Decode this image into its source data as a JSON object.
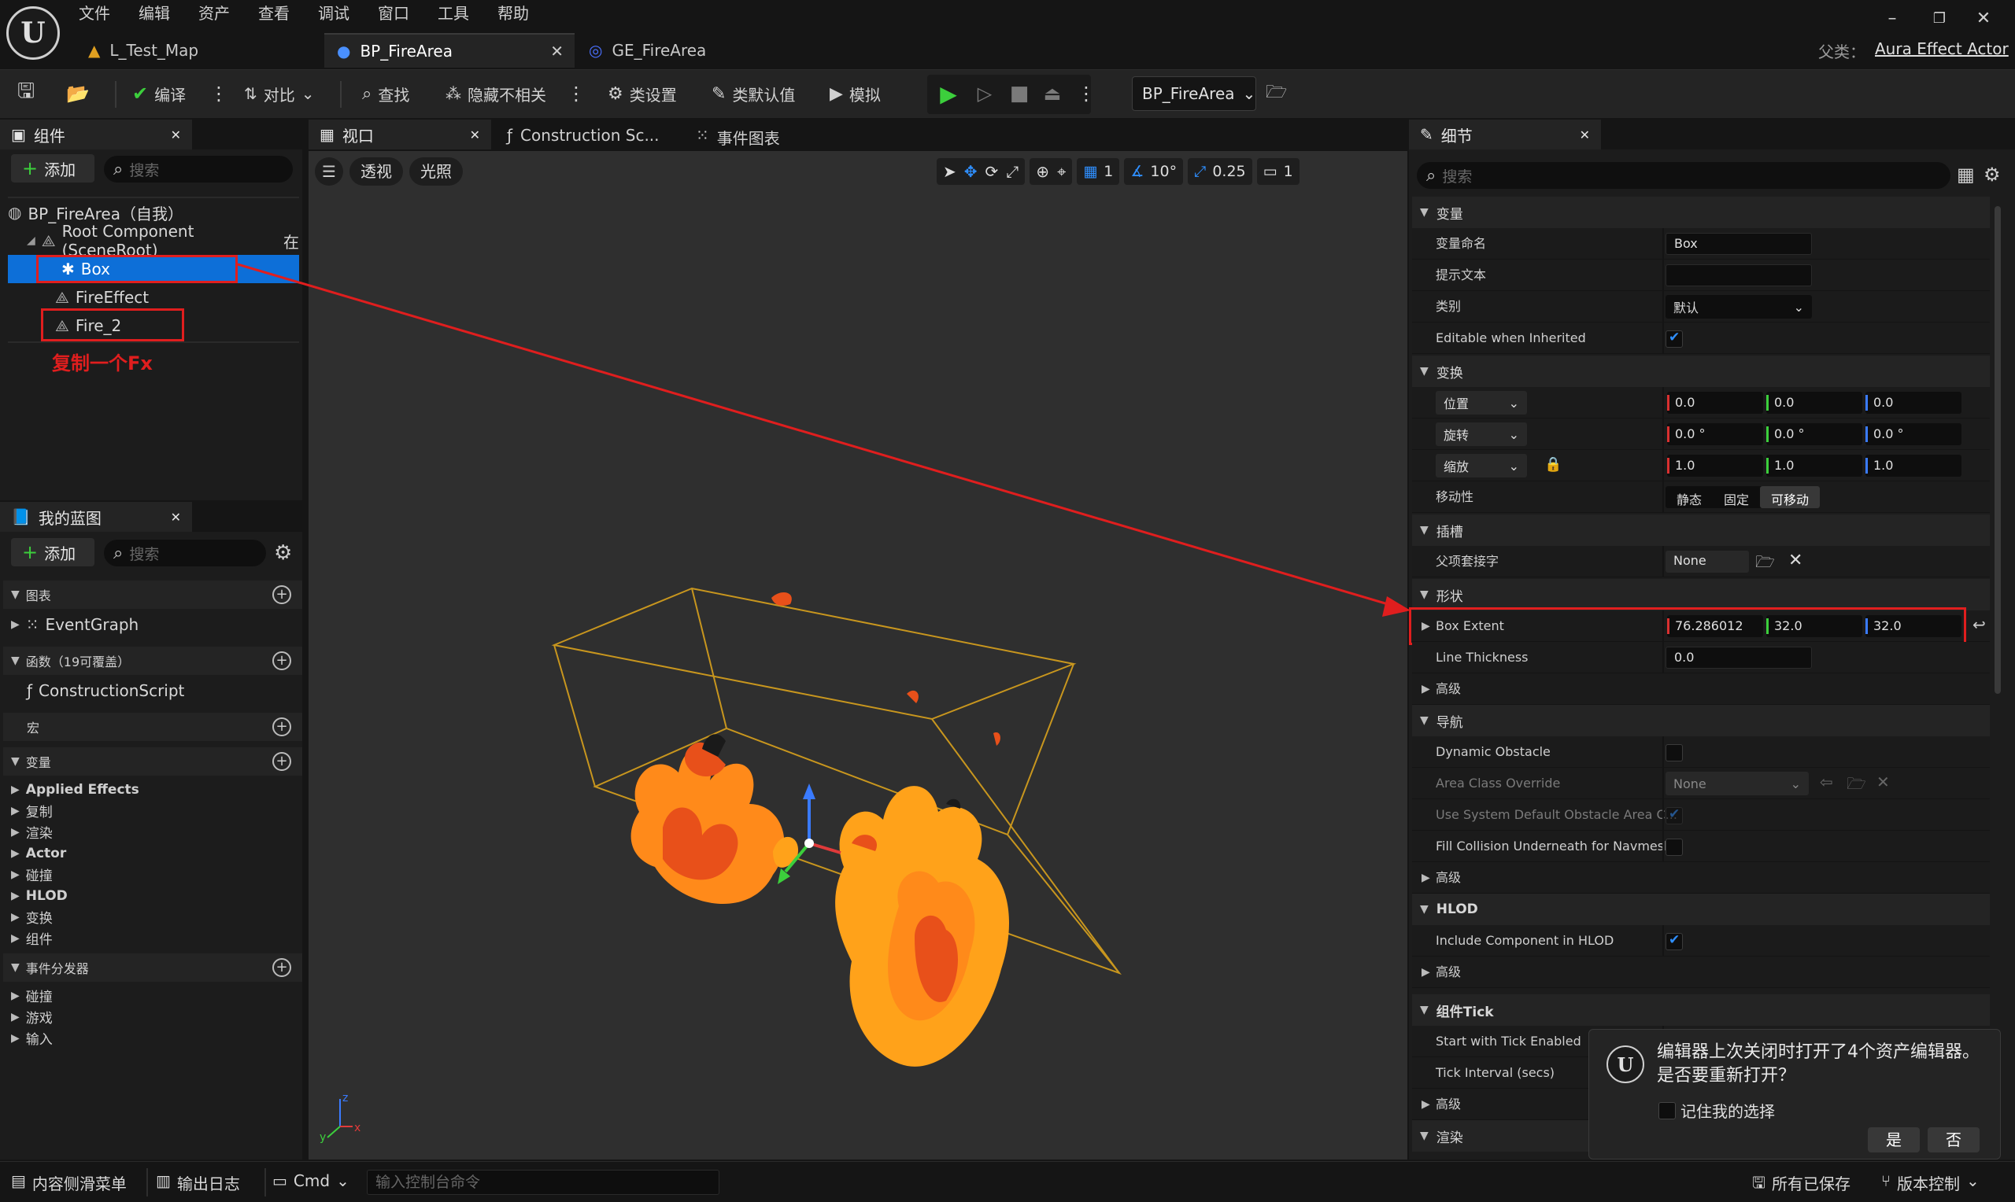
{
  "menu": [
    "文件",
    "编辑",
    "资产",
    "查看",
    "调试",
    "窗口",
    "工具",
    "帮助"
  ],
  "tabs": [
    {
      "label": "L_Test_Map"
    },
    {
      "label": "BP_FireArea"
    },
    {
      "label": "GE_FireArea"
    }
  ],
  "parent_class": {
    "label": "父类：",
    "value": "Aura Effect Actor"
  },
  "toolbar": {
    "compile": "编译",
    "diff": "对比",
    "find": "查找",
    "hide_unrelated": "隐藏不相关",
    "class_settings": "类设置",
    "class_defaults": "类默认值",
    "simulate": "模拟",
    "debug_object": "BP_FireArea"
  },
  "components": {
    "title": "组件",
    "add": "添加",
    "search_placeholder": "搜索",
    "tree": {
      "root": "BP_FireArea（自我）",
      "root_component": "Root Component (SceneRoot)",
      "root_suffix": "在",
      "box": "Box",
      "fire_effect": "FireEffect",
      "fire2": "Fire_2"
    },
    "annotation": "复制一个Fx"
  },
  "my_blueprint": {
    "title": "我的蓝图",
    "add": "添加",
    "search_placeholder": "搜索",
    "graphs": {
      "label": "图表",
      "items": [
        "EventGraph"
      ]
    },
    "functions": {
      "label": "函数（19可覆盖）",
      "items": [
        "ConstructionScript"
      ]
    },
    "macros": {
      "label": "宏"
    },
    "variables": {
      "label": "变量",
      "items": [
        "Applied Effects",
        "复制",
        "渲染",
        "Actor",
        "碰撞",
        "HLOD",
        "变换",
        "组件"
      ]
    },
    "dispatchers": {
      "label": "事件分发器",
      "items": [
        "碰撞",
        "游戏",
        "输入"
      ]
    }
  },
  "viewport": {
    "tabs": [
      "视口",
      "Construction Sc...",
      "事件图表"
    ],
    "perspective": "透视",
    "lighting": "光照",
    "grid_value": "1",
    "angle_value": "10°",
    "scale_value": "0.25",
    "camera_value": "1"
  },
  "details": {
    "title": "细节",
    "search_placeholder": "搜索",
    "sections": {
      "variable": {
        "label": "变量",
        "name_label": "变量命名",
        "name_value": "Box",
        "tooltip_label": "提示文本",
        "category_label": "类别",
        "category_value": "默认",
        "editable_label": "Editable when Inherited"
      },
      "transform": {
        "label": "变换",
        "location": "位置",
        "rotation": "旋转",
        "scale": "缩放",
        "loc": [
          "0.0",
          "0.0",
          "0.0"
        ],
        "rot": [
          "0.0 °",
          "0.0 °",
          "0.0 °"
        ],
        "scl": [
          "1.0",
          "1.0",
          "1.0"
        ],
        "mobility_label": "移动性",
        "mobility_options": [
          "静态",
          "固定",
          "可移动"
        ],
        "mobility_selected": "可移动"
      },
      "socket": {
        "label": "插槽",
        "parent_socket_label": "父项套接字",
        "parent_socket_value": "None"
      },
      "shape": {
        "label": "形状",
        "box_extent_label": "Box Extent",
        "box_extent": [
          "76.286012",
          "32.0",
          "32.0"
        ],
        "line_thickness_label": "Line Thickness",
        "line_thickness": "0.0",
        "advanced": "高级"
      },
      "navigation": {
        "label": "导航",
        "dynamic_obstacle": "Dynamic Obstacle",
        "area_class_override": "Area Class Override",
        "area_class_value": "None",
        "use_default_obstacle": "Use System Default Obstacle Area C...",
        "fill_collision": "Fill Collision Underneath for Navmesh",
        "advanced": "高级"
      },
      "hlod": {
        "label": "HLOD",
        "include_in_hlod": "Include Component in HLOD",
        "advanced": "高级"
      },
      "tick": {
        "label": "组件Tick",
        "start_with_tick": "Start with Tick Enabled",
        "tick_interval": "Tick Interval (secs)",
        "advanced": "高级"
      },
      "render": {
        "label": "渲染"
      }
    }
  },
  "notification": {
    "message": "编辑器上次关闭时打开了4个资产编辑器。是否要重新打开？",
    "remember": "记住我的选择",
    "yes": "是",
    "no": "否"
  },
  "statusbar": {
    "content_drawer": "内容侧滑菜单",
    "output_log": "输出日志",
    "cmd": "Cmd",
    "console_placeholder": "输入控制台命令",
    "all_saved": "所有已保存",
    "source_control": "版本控制"
  },
  "colors": {
    "accent": "#0070e0",
    "annotation": "#e01e1e",
    "fire_dark": "#e8501a",
    "fire_light": "#ffa21a",
    "bounds": "#c8961e"
  }
}
